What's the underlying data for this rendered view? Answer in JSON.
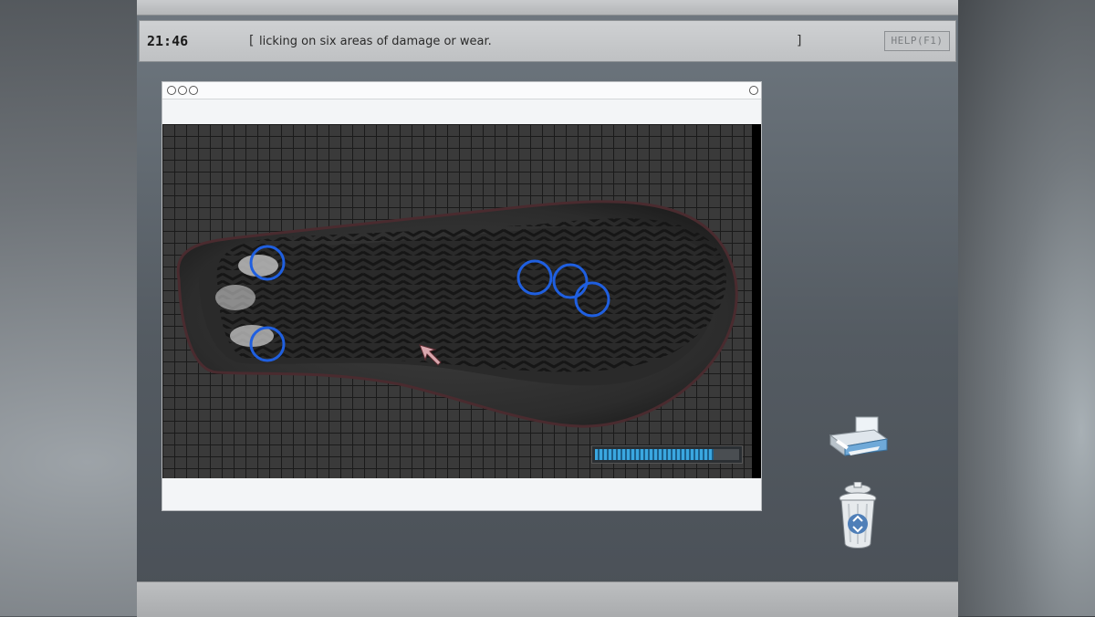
{
  "header": {
    "clock": "21:46",
    "bracket_open": "[",
    "message": "licking on six areas of damage or wear.",
    "bracket_close": "]",
    "help_label": "HELP(F1)"
  },
  "scan": {
    "found_areas": 6,
    "progress_fraction": 0.82
  },
  "colors": {
    "marker": "#1f5fe0",
    "progress": "#3aa7e0"
  },
  "icons": [
    "printer-icon",
    "recycle-bin-icon",
    "pointer-cursor-icon"
  ]
}
